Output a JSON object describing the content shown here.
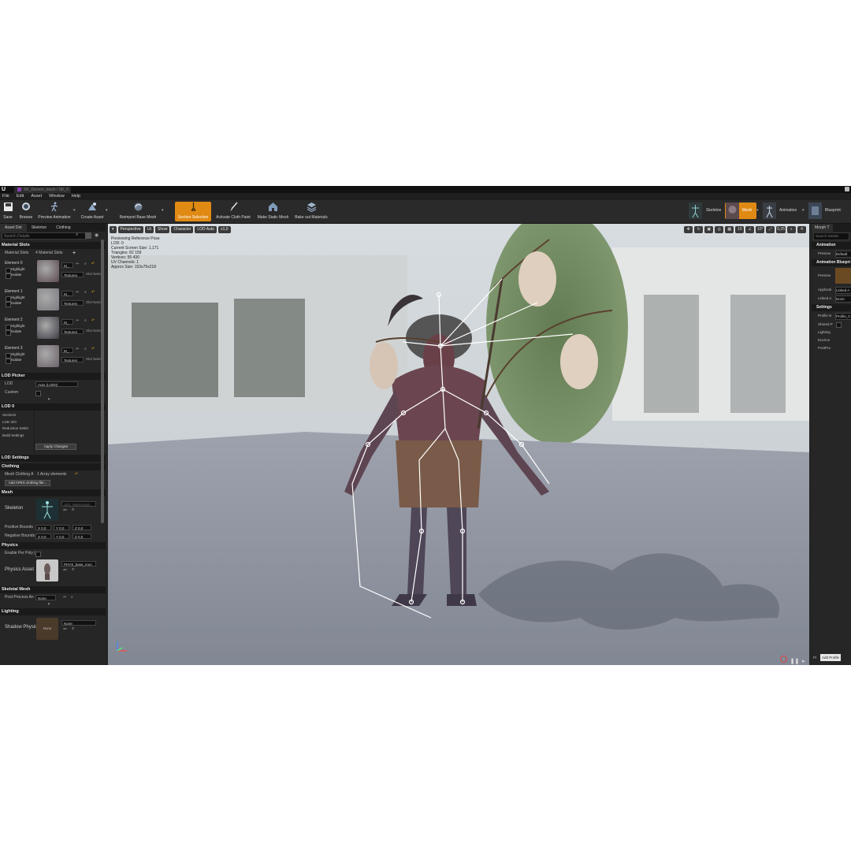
{
  "window": {
    "tab_title": "SK_Demon_mesh / SK_0"
  },
  "menu": [
    "File",
    "Edit",
    "Asset",
    "Window",
    "Help"
  ],
  "toolbar": {
    "save": "Save",
    "browse": "Browse",
    "preview_animation": "Preview Animation",
    "create_asset": "Create Asset",
    "reimport": "Reimport Base Mesh",
    "section_selection": "Section Selection",
    "activate_cloth": "Activate Cloth Paint",
    "make_static": "Make Static Mesh",
    "bake_materials": "Bake out Materials"
  },
  "modes": {
    "skeleton": "Skeleton",
    "mesh": "Mesh",
    "animation": "Animation",
    "blueprint": "Blueprint"
  },
  "left_panel": {
    "tabs": [
      "Asset Det",
      "Skeleton",
      "Clothing"
    ],
    "search_placeholder": "Search Details",
    "material_slots_header": "Material Slots",
    "material_slots_label": "Material Slots",
    "material_slots_count": "4 Material Slots",
    "elements": [
      {
        "name": "Element 0",
        "material": "M_",
        "textures": "Textures",
        "slot": "Slot Name"
      },
      {
        "name": "Element 1",
        "material": "M_",
        "textures": "Textures",
        "slot": "Slot Name"
      },
      {
        "name": "Element 2",
        "material": "M_",
        "textures": "Textures",
        "slot": "Slot Name"
      },
      {
        "name": "Element 3",
        "material": "M_",
        "textures": "Textures",
        "slot": "Slot Name"
      }
    ],
    "highlight": "Highlight",
    "isolate": "Isolate",
    "lod_picker": "LOD Picker",
    "lod_label": "LOD",
    "lod_value": "Auto (LOD0)",
    "custom": "Custom",
    "lod0": "LOD 0",
    "lod0_items": [
      "Sections",
      "LOD Info",
      "Reduction Settin",
      "Build Settings"
    ],
    "apply_changes": "Apply Changes",
    "lod_settings": "LOD Settings",
    "clothing": "Clothing",
    "mesh_clothing": "Mesh Clothing A",
    "array": "1 Array elements",
    "add_apex": "Add APEX clothing file...",
    "mesh": "Mesh",
    "skeleton": "Skeleton",
    "skeleton_value": "UE4_Mannequin_",
    "positive_bounds": "Positive Bounds",
    "negative_bounds": "Negative Bounds",
    "bounds_x": "0,0",
    "bounds_y": "0,0",
    "bounds_z": "0,0",
    "physics": "Physics",
    "enable_per_poly": "Enable Per Poly (",
    "physics_asset": "Physics Asset",
    "physics_asset_value": "PHYS_base_mon",
    "skeletal_mesh": "Skeletal Mesh",
    "post_process": "Post Process An",
    "post_process_value": "None",
    "lighting": "Lighting",
    "shadow_physics": "Shadow Physics",
    "shadow_value": "None",
    "thumb_none": "None"
  },
  "viewport": {
    "perspective": "Perspective",
    "lit": "Lit",
    "show": "Show",
    "character": "Character",
    "lod_auto": "LOD Auto",
    "speed": "x1,0",
    "stats": [
      "Previewing Reference Pose",
      "LOD: 0",
      "Current Screen Size: 1,171",
      "Triangles: 82 159",
      "Vertices: 55 430",
      "UV Channels: 1",
      "Approx Size: 153x75x218"
    ],
    "grid_snap": "10",
    "rot_snap": "10°",
    "scale_snap": "0,25",
    "cam_speed": "4"
  },
  "right_panel": {
    "tab": "Morph T",
    "search_placeholder": "Search Details",
    "animation": "Animation",
    "preview": "Preview",
    "preview_value": "Default",
    "anim_blueprint": "Animation Bluepri",
    "preview2": "Preview",
    "applied": "Applicati",
    "applied_value": "Linked A",
    "linked": "Linked A",
    "linked_value": "None",
    "settings": "Settings",
    "profile_name": "Profile N",
    "profile_value": "Profile_0",
    "shared": "Shared P",
    "items": [
      "Lighting",
      "Environ",
      "PostPro"
    ],
    "add_profile": "Add Profile",
    "pr": "Pr"
  },
  "colors": {
    "accent": "#e08a14",
    "panel": "#262626",
    "ground": "#8e939f"
  }
}
